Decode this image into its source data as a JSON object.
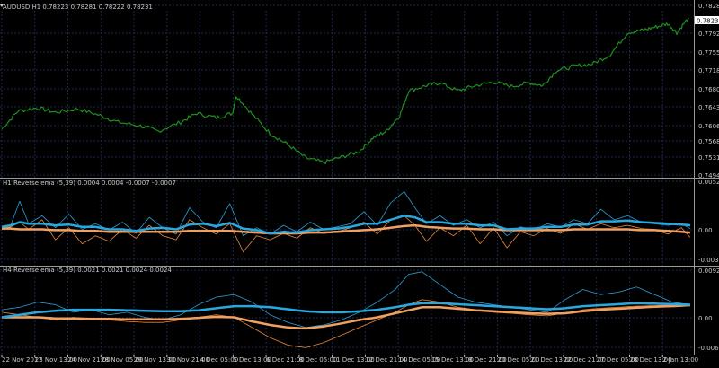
{
  "window": {
    "price_title": "AUDUSD,H1  0.78223 0.78281 0.78222 0.78231",
    "h1_title": "H1 Reverse ema (5,39) 0.0004 0.0004 -0.0007 -0.0007",
    "h4_title": "H4 Reverse ema (5,39) 0.0021 0.0021 0.0024 0.0024",
    "current_price": "0.78231"
  },
  "colors": {
    "background": "#000000",
    "grid": "#1e2850",
    "separator": "#9a9a9a",
    "axis_text": "#c8c8c8",
    "price": "#1f8f1f",
    "price_label_bg": "#ffffff",
    "indicator_fast": "#2a9fd6",
    "indicator_thick": "#29a8e0",
    "indicator_orange": "#e8893a",
    "indicator_orange_thick": "#f0a060"
  },
  "price_axis": {
    "ticks": [
      "0.78281",
      "0.77920",
      "0.77550",
      "0.77180",
      "0.76800",
      "0.76430",
      "0.76060",
      "0.75680",
      "0.75310",
      "0.74940"
    ]
  },
  "h1_axis": {
    "ticks": [
      "0.0052",
      "0.00",
      "-0.0037"
    ]
  },
  "h4_axis": {
    "ticks": [
      "0.0092",
      "0.00",
      "-0.0065"
    ]
  },
  "time_axis": {
    "labels": [
      "22 Nov 2017",
      "23 Nov 13:00",
      "24 Nov 21:00",
      "28 Nov 05:00",
      "29 Nov 13:00",
      "30 Nov 21:00",
      "4 Dec 05:00",
      "5 Dec 13:00",
      "6 Dec 21:00",
      "8 Dec 05:00",
      "11 Dec 13:00",
      "12 Dec 21:00",
      "14 Dec 05:00",
      "15 Dec 13:00",
      "18 Dec 21:00",
      "20 Dec 05:00",
      "21 Dec 13:00",
      "22 Dec 21:00",
      "27 Dec 05:00",
      "28 Dec 13:00",
      "2 Jan 13:00"
    ]
  },
  "chart_data": [
    {
      "type": "line",
      "title": "AUDUSD,H1  0.78223 0.78281 0.78222 0.78231",
      "ylim": [
        0.747,
        0.7835
      ],
      "x": [
        0,
        18,
        40,
        60,
        85,
        110,
        130,
        155,
        175,
        200,
        218,
        240,
        258,
        262,
        280,
        300,
        320,
        340,
        360,
        380,
        400,
        415,
        430,
        445,
        455,
        475,
        490,
        510,
        530,
        550,
        570,
        590,
        605,
        620,
        640,
        660,
        680,
        700,
        715,
        730,
        745,
        755,
        768
      ],
      "y": [
        0.7575,
        0.7615,
        0.7622,
        0.7612,
        0.762,
        0.7605,
        0.759,
        0.7582,
        0.757,
        0.759,
        0.761,
        0.76,
        0.761,
        0.765,
        0.7608,
        0.7565,
        0.754,
        0.751,
        0.75,
        0.7512,
        0.7525,
        0.7555,
        0.757,
        0.7605,
        0.766,
        0.7672,
        0.7678,
        0.766,
        0.7672,
        0.768,
        0.767,
        0.7678,
        0.7672,
        0.7705,
        0.7715,
        0.772,
        0.774,
        0.779,
        0.7795,
        0.7802,
        0.781,
        0.779,
        0.7823
      ]
    },
    {
      "type": "line",
      "title": "H1 Reverse ema (5,39) 0.0004 0.0004 -0.0007 -0.0007",
      "ylim": [
        -0.004,
        0.0055
      ],
      "x": [
        0,
        10,
        20,
        30,
        45,
        60,
        75,
        90,
        105,
        120,
        135,
        150,
        165,
        180,
        195,
        210,
        225,
        240,
        255,
        270,
        285,
        300,
        315,
        330,
        345,
        360,
        375,
        390,
        405,
        420,
        435,
        450,
        462,
        475,
        490,
        505,
        520,
        535,
        550,
        565,
        580,
        595,
        610,
        625,
        640,
        655,
        670,
        685,
        700,
        715,
        730,
        745,
        760,
        770
      ],
      "series": [
        {
          "values": [
            0.0005,
            0.0008,
            0.0038,
            0.001,
            0.002,
            0.0005,
            0.0022,
            0.0003,
            0.001,
            0.0002,
            0.0012,
            -0.0002,
            0.0018,
            0.0005,
            -0.0003,
            0.003,
            0.0012,
            0.0005,
            0.0035,
            -0.0005,
            0.0005,
            -0.0003,
            0.0008,
            0.0,
            0.0012,
            0.0003,
            0.0006,
            0.001,
            0.0025,
            0.0008,
            0.0036,
            0.005,
            0.003,
            0.001,
            0.002,
            0.0008,
            0.0015,
            0.0005,
            0.0012,
            -0.0005,
            0.0006,
            0.0002,
            0.001,
            0.0006,
            0.0015,
            0.001,
            0.0028,
            0.0015,
            0.002,
            0.0012,
            0.001,
            0.0008,
            0.001,
            0.0004
          ]
        },
        {
          "values": [
            0.0006,
            0.0008,
            0.0012,
            0.001,
            0.001,
            0.0008,
            0.0009,
            0.0006,
            0.0006,
            0.0003,
            0.0003,
            0.0001,
            0.0004,
            0.0005,
            0.0003,
            0.0009,
            0.001,
            0.0007,
            0.0011,
            0.0004,
            0.0002,
            -0.0002,
            0.0,
            -0.0001,
            0.0002,
            0.0003,
            0.0004,
            0.0006,
            0.001,
            0.001,
            0.0015,
            0.002,
            0.0018,
            0.0012,
            0.0012,
            0.001,
            0.001,
            0.0008,
            0.0008,
            0.0003,
            0.0004,
            0.0004,
            0.0006,
            0.0006,
            0.0009,
            0.0009,
            0.0013,
            0.0013,
            0.0014,
            0.0012,
            0.0011,
            0.001,
            0.0009,
            0.0008
          ]
        },
        {
          "values": [
            0.0004,
            0.0006,
            0.0012,
            0.0003,
            0.0015,
            -0.001,
            0.0005,
            -0.0015,
            -0.0005,
            -0.0012,
            0.0003,
            -0.0008,
            0.0008,
            -0.0005,
            -0.001,
            0.0015,
            0.0005,
            -0.0003,
            0.001,
            -0.0025,
            -0.0005,
            -0.001,
            -0.0002,
            -0.0008,
            0.0005,
            -0.0002,
            0.0,
            0.0005,
            0.0012,
            -0.0003,
            0.0015,
            0.002,
            0.0008,
            -0.0012,
            0.0005,
            -0.0005,
            0.0008,
            -0.0015,
            0.0005,
            -0.002,
            0.0,
            -0.0005,
            0.0004,
            -0.0002,
            0.001,
            0.0003,
            0.001,
            0.0005,
            0.0008,
            0.0004,
            0.0003,
            -0.0003,
            0.0005,
            -0.0007
          ]
        },
        {
          "values": [
            0.0004,
            0.0004,
            0.0003,
            0.0003,
            0.0003,
            0.0002,
            0.0002,
            0.0001,
            0.0001,
            0.0,
            0.0,
            0.0,
            0.0,
            0.0,
            0.0,
            0.0001,
            0.0001,
            0.0001,
            0.0001,
            0.0,
            -0.0001,
            -0.0002,
            -0.0002,
            -0.0002,
            -0.0001,
            -0.0001,
            0.0,
            0.0001,
            0.0002,
            0.0003,
            0.0005,
            0.0007,
            0.0008,
            0.0006,
            0.0005,
            0.0004,
            0.0004,
            0.0003,
            0.0003,
            0.0002,
            0.0002,
            0.0002,
            0.0002,
            0.0002,
            0.0003,
            0.0003,
            0.0003,
            0.0003,
            0.0003,
            0.0002,
            0.0002,
            0.0001,
            0.0,
            -0.0001
          ]
        }
      ]
    },
    {
      "type": "line",
      "title": "H4 Reverse ema (5,39) 0.0021 0.0021 0.0024 0.0024",
      "ylim": [
        -0.007,
        0.0095
      ],
      "x": [
        0,
        20,
        40,
        60,
        80,
        100,
        120,
        140,
        160,
        180,
        200,
        220,
        240,
        260,
        280,
        300,
        320,
        340,
        360,
        380,
        400,
        420,
        440,
        455,
        470,
        490,
        510,
        530,
        550,
        570,
        590,
        610,
        630,
        650,
        670,
        690,
        710,
        730,
        750,
        770
      ],
      "series": [
        {
          "values": [
            0.0015,
            0.002,
            0.003,
            0.0025,
            0.001,
            0.0015,
            0.0005,
            0.001,
            0.0,
            -0.0005,
            0.0005,
            0.0025,
            0.004,
            0.0045,
            0.003,
            0.0005,
            -0.001,
            -0.002,
            -0.0015,
            -0.0005,
            0.001,
            0.003,
            0.0055,
            0.0085,
            0.009,
            0.0065,
            0.004,
            0.003,
            0.0025,
            0.002,
            0.0015,
            0.001,
            0.0035,
            0.0055,
            0.0045,
            0.005,
            0.006,
            0.0045,
            0.003,
            0.0025
          ]
        },
        {
          "values": [
            0.0,
            0.0005,
            0.001,
            0.0013,
            0.0015,
            0.0015,
            0.0015,
            0.0014,
            0.0013,
            0.0012,
            0.0012,
            0.0014,
            0.0018,
            0.0022,
            0.0022,
            0.002,
            0.0016,
            0.0012,
            0.001,
            0.001,
            0.0012,
            0.0015,
            0.002,
            0.0025,
            0.0028,
            0.0028,
            0.0026,
            0.0024,
            0.0022,
            0.002,
            0.0018,
            0.0016,
            0.0018,
            0.0022,
            0.0024,
            0.0026,
            0.0028,
            0.0027,
            0.0026,
            0.0025
          ]
        },
        {
          "values": [
            0.001,
            0.0005,
            0.0,
            -0.0005,
            0.0,
            -0.0003,
            -0.0005,
            -0.0008,
            -0.001,
            -0.001,
            -0.0005,
            0.0,
            0.0005,
            0.0,
            -0.002,
            -0.004,
            -0.0055,
            -0.006,
            -0.005,
            -0.0035,
            -0.002,
            -0.0005,
            0.001,
            0.0025,
            0.0035,
            0.003,
            0.002,
            0.0015,
            0.001,
            0.0008,
            0.0005,
            0.0003,
            0.0008,
            0.0015,
            0.0018,
            0.002,
            0.0022,
            0.0023,
            0.0024,
            0.0024
          ]
        },
        {
          "values": [
            0.0,
            0.0,
            0.0,
            -0.0002,
            -0.0002,
            -0.0003,
            -0.0003,
            -0.0004,
            -0.0004,
            -0.0004,
            -0.0003,
            -0.0001,
            0.0001,
            0.0,
            -0.0008,
            -0.0015,
            -0.002,
            -0.0022,
            -0.0018,
            -0.0012,
            -0.0005,
            0.0,
            0.0008,
            0.0014,
            0.002,
            0.002,
            0.0017,
            0.0014,
            0.0012,
            0.001,
            0.0008,
            0.0007,
            0.0008,
            0.0012,
            0.0015,
            0.0017,
            0.0019,
            0.0021,
            0.0022,
            0.0024
          ]
        }
      ]
    }
  ]
}
